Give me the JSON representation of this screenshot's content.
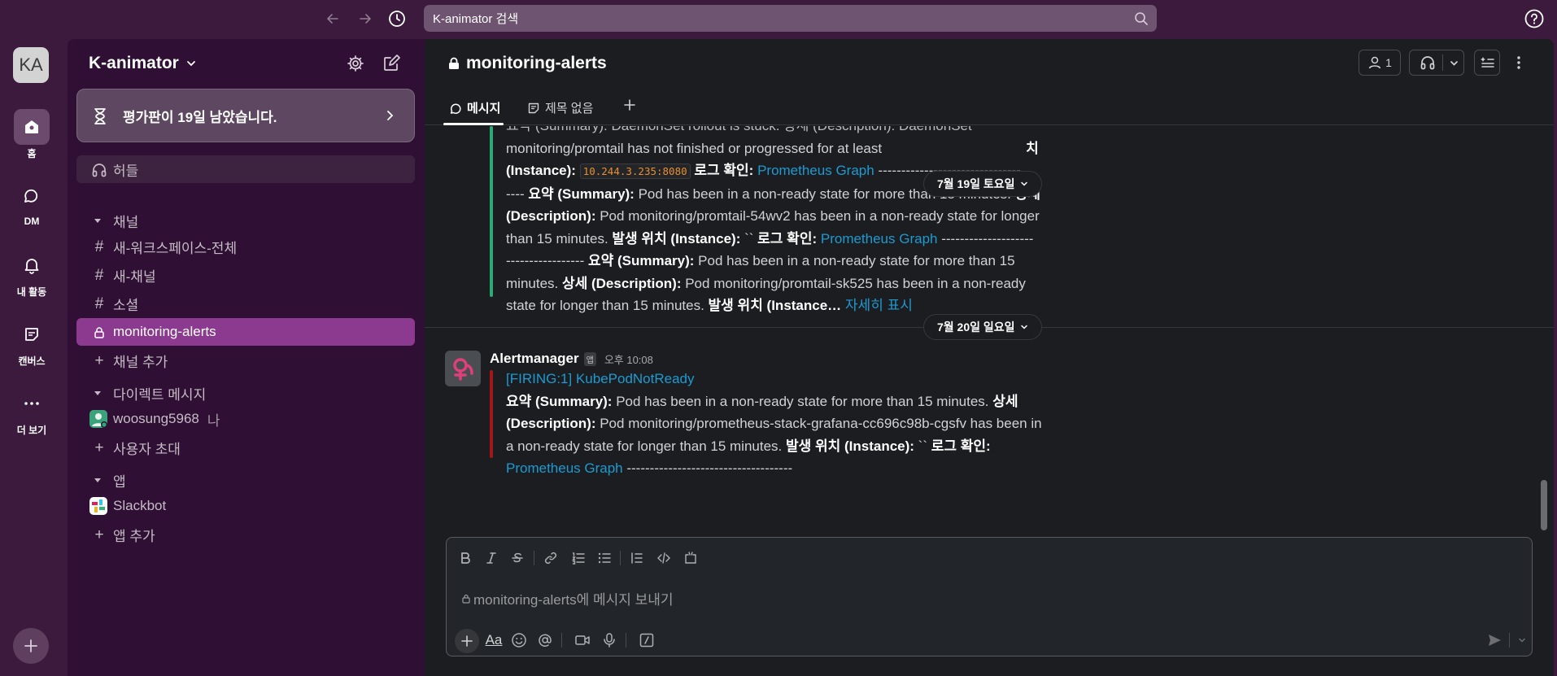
{
  "topbar": {
    "search_placeholder": "K-animator 검색",
    "icons": [
      "arrow-left-icon",
      "arrow-right-icon",
      "history-icon",
      "search-icon",
      "help-icon"
    ]
  },
  "rail": {
    "workspace_initials": "KA",
    "items": [
      {
        "label": "홈",
        "icon": "home-icon"
      },
      {
        "label": "DM",
        "icon": "dm-icon"
      },
      {
        "label": "내 활동",
        "icon": "bell-icon"
      },
      {
        "label": "캔버스",
        "icon": "canvas-icon"
      },
      {
        "label": "더 보기",
        "icon": "more-icon"
      }
    ]
  },
  "sidebar": {
    "workspace_name": "K-animator",
    "trial_text": "평가판이 19일 남았습니다.",
    "huddle_label": "허들",
    "channels_section": "채널",
    "channels": [
      "새-워크스페이스-전체",
      "새-채널",
      "소셜",
      "monitoring-alerts"
    ],
    "add_channel": "채널 추가",
    "dm_section": "다이렉트 메시지",
    "dm_user": "woosung5968",
    "dm_user_suffix": "나",
    "invite_user": "사용자 초대",
    "apps_section": "앱",
    "app_slackbot": "Slackbot",
    "add_app": "앱 추가"
  },
  "channel": {
    "name": "monitoring-alerts",
    "member_count": "1",
    "tabs": [
      "메시지",
      "제목 없음"
    ]
  },
  "messages": {
    "first": {
      "line0": "요약 (Summary): DaemonSet rollout is stuck. 상세 (Description): DaemonSet",
      "line1": "monitoring/promtail has not finished or progressed for at least",
      "line1_tail": "치",
      "line2_a": "(Instance):",
      "line2_code": "10.244.3.235:8080",
      "line2_b": "로그 확인:",
      "line2_link": "Prometheus Graph",
      "line2_dashes": "-------------------------------",
      "line3_a": "---- ",
      "line3_b": "요약 (Summary):",
      "line3_c": " Pod has been in a non-ready state for more than 15 minutes. ",
      "line3_d": "상세",
      "line4_a": "(Description):",
      "line4_b": " Pod monitoring/promtail-54wv2 has been in a non-ready state for longer",
      "line5_a": "than 15 minutes. ",
      "line5_b": "발생 위치 (Instance):",
      "line5_c": " `` ",
      "line5_d": "로그 확인:",
      "line5_link": "Prometheus Graph",
      "line5_dashes": " --------------------",
      "line6_a": "----------------- ",
      "line6_b": "요약 (Summary):",
      "line6_c": " Pod has been in a non-ready state for more than 15",
      "line7_a": "minutes. ",
      "line7_b": "상세 (Description):",
      "line7_c": " Pod monitoring/promtail-sk525 has been in a non-ready",
      "line8_a": "state for longer than 15 minutes. ",
      "line8_b": "발생 위치 (Instance…",
      "line8_link": "자세히 표시"
    },
    "date1": "7월 19일 토요일",
    "date2": "7월 20일 일요일",
    "second": {
      "author": "Alertmanager",
      "app_badge": "앱",
      "time": "오후 10:08",
      "title_link": "[FIRING:1] KubePodNotReady",
      "l1_a": "요약 (Summary):",
      "l1_b": " Pod has been in a non-ready state for more than 15 minutes. ",
      "l1_c": "상세",
      "l2_a": "(Description):",
      "l2_b": " Pod monitoring/prometheus-stack-grafana-cc696c98b-cgsfv has been in",
      "l3_a": "a non-ready state for longer than 15 minutes. ",
      "l3_b": "발생 위치 (Instance):",
      "l3_c": " `` ",
      "l3_d": "로그 확인:",
      "l4_link": "Prometheus Graph",
      "l4_dashes": " ------------------------------------"
    }
  },
  "composer": {
    "placeholder": "monitoring-alerts에 메시지 보내기",
    "format_icons": [
      "bold-icon",
      "italic-icon",
      "strikethrough-icon",
      "link-icon",
      "ordered-list-icon",
      "bullet-list-icon",
      "blockquote-icon",
      "code-icon",
      "code-block-icon"
    ],
    "bottom_icons": [
      "plus-icon",
      "text-format-icon",
      "emoji-icon",
      "mention-icon",
      "video-icon",
      "microphone-icon",
      "slash-command-icon",
      "send-icon",
      "chevron-down-icon"
    ]
  },
  "colors": {
    "accent_active": "#8c3a8f",
    "link": "#1d9bd1",
    "quote_green": "#2bac76",
    "quote_red": "#a4161a"
  }
}
